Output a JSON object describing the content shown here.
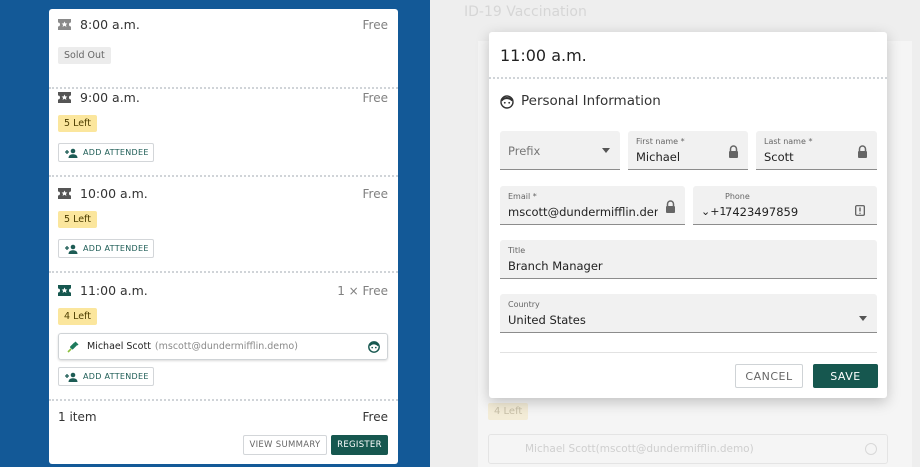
{
  "tickets": {
    "slots": [
      {
        "time": "8:00 a.m.",
        "price": "Free",
        "badge": "Sold Out"
      },
      {
        "time": "9:00 a.m.",
        "price": "Free",
        "badge": "5 Left",
        "add_label": "ADD ATTENDEE"
      },
      {
        "time": "10:00 a.m.",
        "price": "Free",
        "badge": "5 Left",
        "add_label": "ADD ATTENDEE"
      },
      {
        "time": "11:00 a.m.",
        "price": "1 × Free",
        "badge": "4 Left",
        "add_label": "ADD ATTENDEE"
      }
    ],
    "attendee": {
      "name": "Michael Scott",
      "email": "(mscott@dundermifflin.demo)"
    },
    "footer": {
      "count": "1 item",
      "total": "Free",
      "summary_label": "VIEW SUMMARY",
      "register_label": "REGISTER"
    }
  },
  "background": {
    "page_title": "ID-19 Vaccination",
    "badge": "4 Left",
    "attendee_name": "Michael Scott",
    "attendee_email": "(mscott@dundermifflin.demo)"
  },
  "modal": {
    "title": "11:00 a.m.",
    "section_title": "Personal Information",
    "fields": {
      "prefix": {
        "placeholder": "Prefix"
      },
      "first_name": {
        "label": "First name *",
        "value": "Michael"
      },
      "last_name": {
        "label": "Last name *",
        "value": "Scott"
      },
      "email": {
        "label": "Email *",
        "value": "mscott@dundermifflin.demo"
      },
      "phone": {
        "label": "Phone",
        "country_code": "+1",
        "value": "7423497859"
      },
      "title": {
        "label": "Title",
        "value": "Branch Manager"
      },
      "country": {
        "label": "Country",
        "value": "United States"
      }
    },
    "cancel_label": "CANCEL",
    "save_label": "SAVE"
  },
  "colors": {
    "brand_blue": "#135997",
    "primary_green": "#16574f",
    "badge_yellow": "#fbe69d"
  }
}
